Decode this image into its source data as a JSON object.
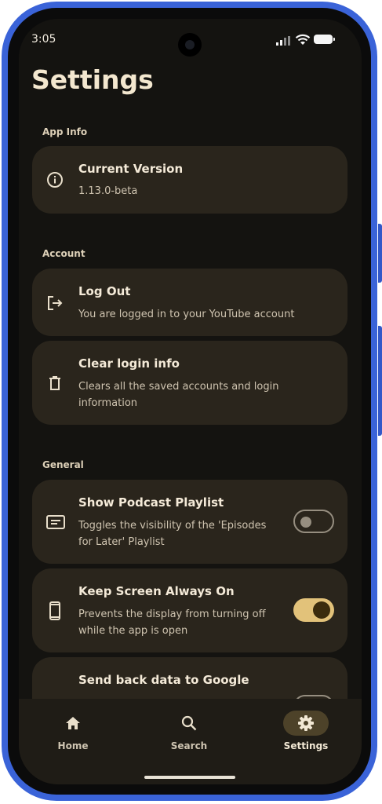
{
  "status_bar": {
    "time": "3:05"
  },
  "page": {
    "title": "Settings"
  },
  "sections": {
    "app_info": {
      "label": "App Info",
      "current_version": {
        "title": "Current Version",
        "subtitle": "1.13.0-beta",
        "icon": "info-icon"
      }
    },
    "account": {
      "label": "Account",
      "log_out": {
        "title": "Log Out",
        "subtitle": "You are logged in to your YouTube account",
        "icon": "logout-icon"
      },
      "clear_login": {
        "title": "Clear login info",
        "subtitle_line1": "Clears all the saved accounts and login",
        "subtitle_line2": "information",
        "icon": "trash-icon"
      }
    },
    "general": {
      "label": "General",
      "show_podcast": {
        "title": "Show Podcast Playlist",
        "subtitle_line1": "Toggles the visibility of the 'Episodes",
        "subtitle_line2": "for Later' Playlist",
        "icon": "playlist-icon",
        "enabled": false
      },
      "keep_screen": {
        "title": "Keep Screen Always On",
        "subtitle_line1": "Prevents the display from turning off",
        "subtitle_line2": "while the app is open",
        "icon": "phone-icon",
        "enabled": true
      },
      "send_data": {
        "title": "Send back data to Google",
        "enabled": false
      }
    }
  },
  "nav": {
    "home": {
      "label": "Home",
      "icon": "home-icon"
    },
    "search": {
      "label": "Search",
      "icon": "search-icon"
    },
    "settings": {
      "label": "Settings",
      "icon": "gear-icon",
      "active": true
    }
  },
  "colors": {
    "background": "#141310",
    "card": "#2a251c",
    "accent": "#e2c27a",
    "frame": "#3a63d8"
  }
}
